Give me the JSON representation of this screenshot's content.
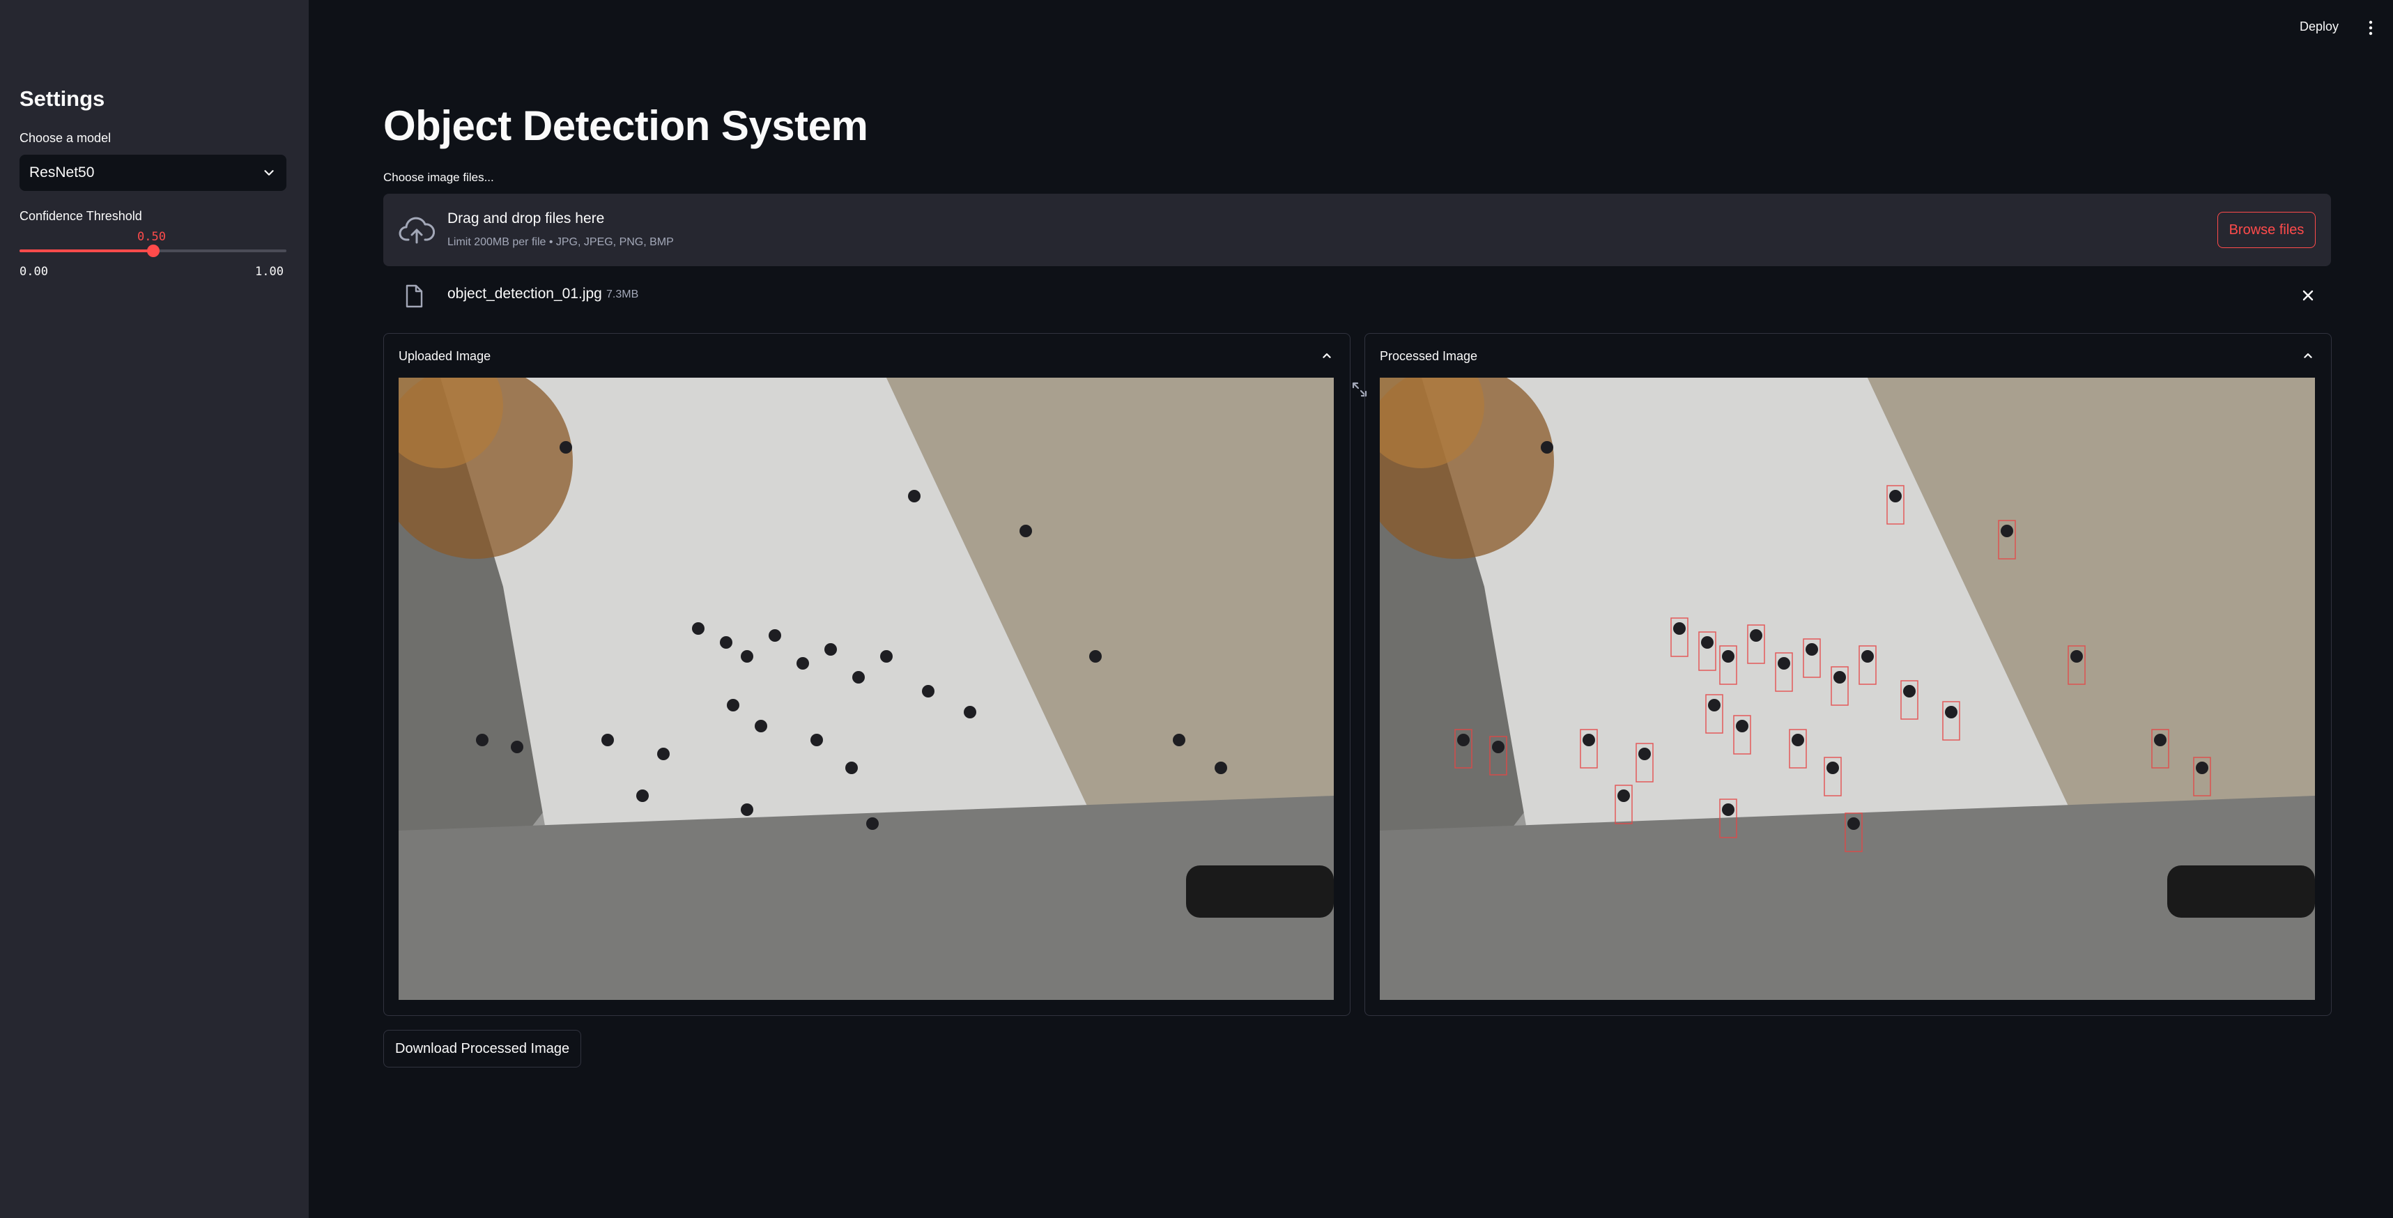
{
  "sidebar": {
    "title": "Settings",
    "model_label": "Choose a model",
    "model_selected": "ResNet50",
    "threshold_label": "Confidence Threshold",
    "threshold_value": "0.50",
    "threshold_fraction": 0.5,
    "threshold_min": "0.00",
    "threshold_max": "1.00"
  },
  "topbar": {
    "deploy_label": "Deploy",
    "menu_icon": "kebab-menu-icon"
  },
  "main": {
    "title": "Object Detection System",
    "uploader_label": "Choose image files...",
    "dropzone_title": "Drag and drop files here",
    "dropzone_limits": "Limit 200MB per file • JPG, JPEG, PNG, BMP",
    "browse_label": "Browse files",
    "file": {
      "name": "object_detection_01.jpg",
      "size": "7.3MB"
    },
    "uploaded_panel_label": "Uploaded Image",
    "processed_panel_label": "Processed Image",
    "download_label": "Download Processed Image"
  },
  "colors": {
    "accent": "#ff4b4b",
    "background": "#0e1117",
    "sidebar": "#262730"
  }
}
